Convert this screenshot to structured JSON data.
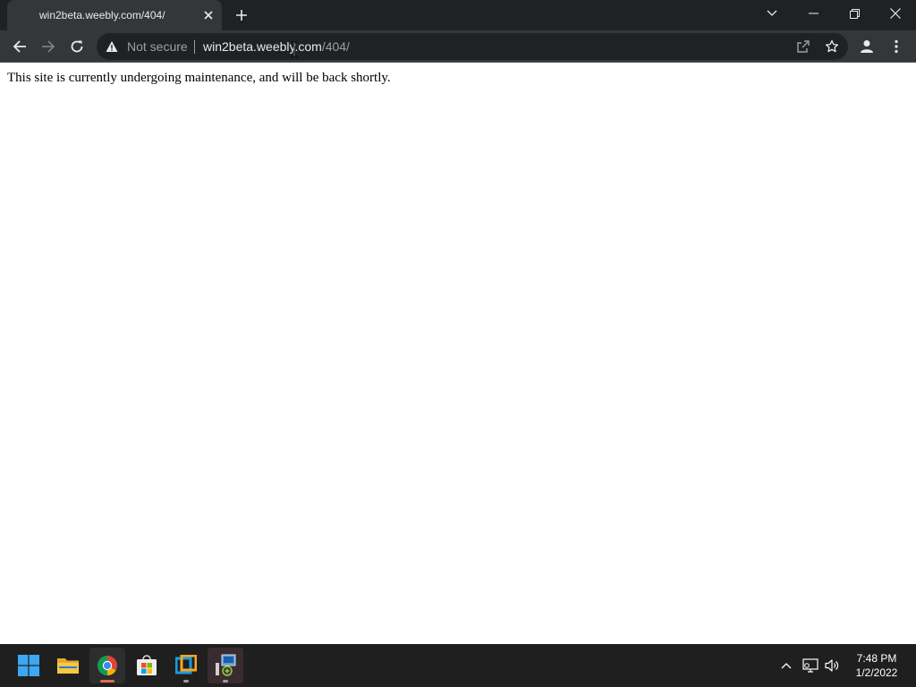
{
  "browser": {
    "tab": {
      "title": "win2beta.weebly.com/404/"
    },
    "omnibox": {
      "security_label": "Not secure",
      "url_host": "win2beta.weebly.com",
      "url_path": "/404/"
    }
  },
  "page": {
    "message": "This site is currently undergoing maintenance, and will be back shortly."
  },
  "taskbar": {
    "apps": [
      {
        "name": "start",
        "icon": "windows-logo-icon"
      },
      {
        "name": "file-explorer",
        "icon": "folder-icon"
      },
      {
        "name": "chrome",
        "icon": "chrome-icon",
        "active": true
      },
      {
        "name": "microsoft-store",
        "icon": "store-icon"
      },
      {
        "name": "vmware",
        "icon": "vmware-icon"
      },
      {
        "name": "app",
        "icon": "app-window-icon"
      }
    ],
    "clock": {
      "time": "7:48 PM",
      "date": "1/2/2022"
    }
  },
  "colors": {
    "titlebar": "#202124",
    "toolbar": "#35363a",
    "omnibox": "#202124",
    "taskbar": "#1f1f1f",
    "chrome_active_indicator": "#e06c4f"
  }
}
